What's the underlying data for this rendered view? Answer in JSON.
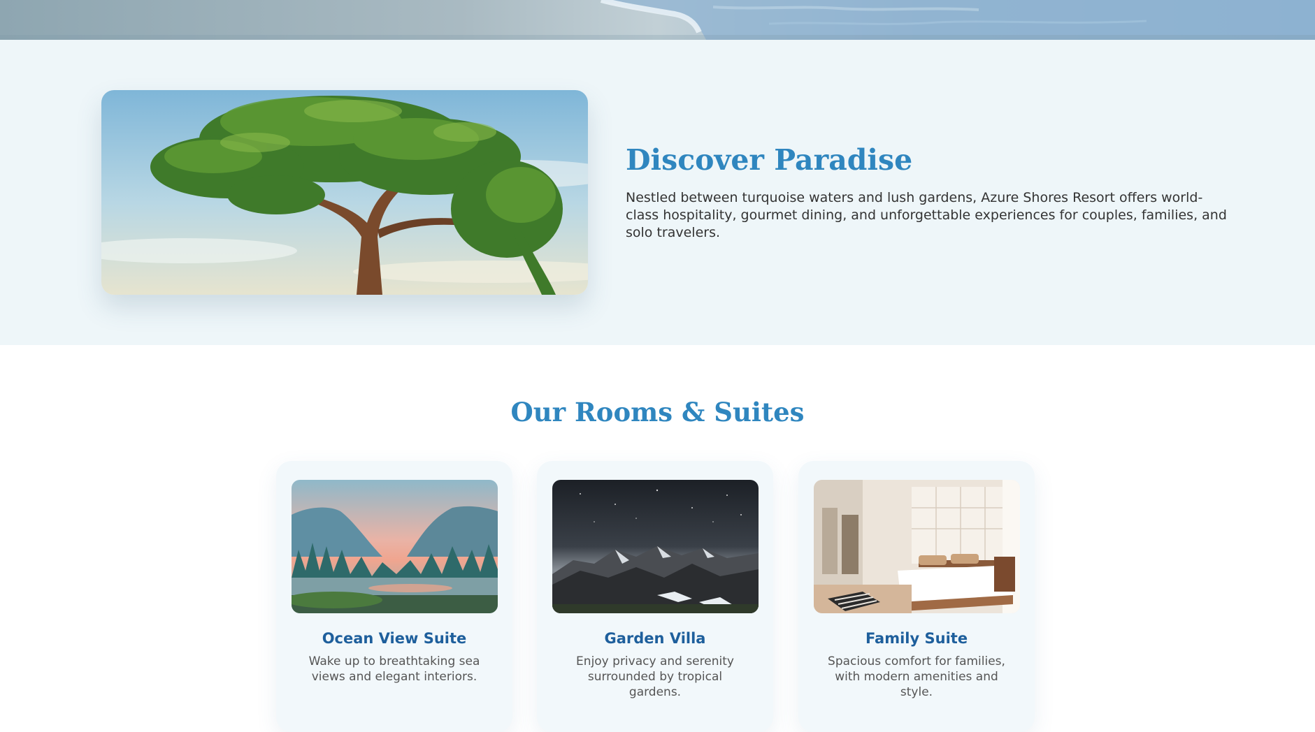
{
  "about": {
    "title": "Discover Paradise",
    "body": "Nestled between turquoise waters and lush gardens, Azure Shores Resort offers world-class hospitality, gourmet dining, and unforgettable experiences for couples, families, and solo travelers."
  },
  "rooms": {
    "title": "Our Rooms & Suites",
    "items": [
      {
        "name": "Ocean View Suite",
        "description": "Wake up to breathtaking sea views and elegant interiors."
      },
      {
        "name": "Garden Villa",
        "description": "Enjoy privacy and serenity surrounded by tropical gardens."
      },
      {
        "name": "Family Suite",
        "description": "Spacious comfort for families, with modern amenities and style."
      }
    ]
  },
  "colors": {
    "accent": "#2f86bf",
    "room_name": "#1e5f9c",
    "about_background": "#eef6f9",
    "card_background": "#f2f8fb"
  }
}
